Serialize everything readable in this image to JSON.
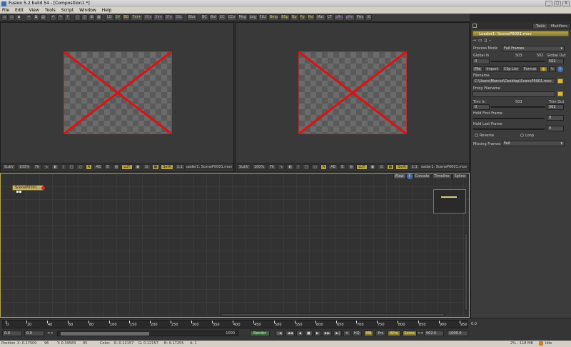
{
  "window": {
    "title": "Fusion 5.2 build 54 - [Composition1 *]",
    "minimize": "_",
    "maximize": "□",
    "close": "X"
  },
  "menu": [
    "File",
    "Edit",
    "View",
    "Tools",
    "Script",
    "Window",
    "Help"
  ],
  "toolbar": [
    "Bg",
    "BC",
    "Bol",
    "CC",
    "CCv",
    "Msg",
    "Log",
    "FLU",
    "Bmp",
    "BSp",
    "Bp",
    "Pp",
    "Rsl",
    "Mat",
    "CT",
    "pRn",
    "pRn",
    "Pisc",
    "XI"
  ],
  "toolbar_colored": [
    {
      "label": "LD",
      "tone": "grn"
    },
    {
      "label": "SV",
      "tone": "grn"
    },
    {
      "label": "BG",
      "tone": "yel"
    },
    {
      "label": "Txt+",
      "tone": "yel"
    },
    {
      "label": "3Cv",
      "tone": "pur"
    },
    {
      "label": "3Im",
      "tone": "pur"
    },
    {
      "label": "3Fo",
      "tone": "pur"
    },
    {
      "label": "3SL",
      "tone": "pur"
    },
    {
      "label": "Blur",
      "tone": ""
    }
  ],
  "viewer_left": {
    "sub": "SubV",
    "zoom": "100%",
    "fit": "Fit",
    "lut": "LUT",
    "smr": "SmR",
    "ratio": "1:1",
    "label": "oader1: SceneP0001.mov"
  },
  "viewer_right": {
    "sub": "SubV",
    "zoom": "100%",
    "fit": "Fit",
    "lut": "LUT",
    "smr": "SmR",
    "ratio": "1:1",
    "label": "oader1: SceneP0001.mov"
  },
  "panel": {
    "tabs": [
      "Tools",
      "Modifiers"
    ],
    "header": "Loader1: SceneP0001.mov",
    "process_mode_label": "Process Mode",
    "process_mode_value": "Full Frames",
    "global_in_label": "Global In",
    "global_in_value": "0",
    "global_mid": "503",
    "global_end": "502",
    "global_out_label": "Global Out",
    "global_out_value": "502",
    "subtabs": [
      "File",
      "Import",
      "Clip List",
      "Format"
    ],
    "filename_label": "Filename",
    "filename_value": "C:\\Users\\Marcos\\Desktop\\SceneP0001.mov",
    "proxy_label": "Proxy Filename",
    "trim_in_label": "Trim In",
    "trim_mid": "503",
    "trim_out_label": "Trim Out",
    "trim_in_value": "0",
    "trim_out_value": "502",
    "hold_first_label": "Hold First Frame",
    "hold_first_value": "0",
    "hold_last_label": "Hold Last Frame",
    "hold_last_value": "0",
    "reverse_label": "Reverse",
    "loop_label": "Loop",
    "missing_label": "Missing Frames",
    "missing_value": "Fail"
  },
  "flow": {
    "tabs": [
      "Flow",
      "Console",
      "Timeline",
      "Spline"
    ],
    "node_label": "SceneP0001..."
  },
  "timeline": {
    "ticks": [
      "0",
      "20",
      "40",
      "60",
      "80",
      "100",
      "150",
      "200",
      "250",
      "300",
      "350",
      "400",
      "450",
      "500",
      "550",
      "600",
      "650",
      "700",
      "750",
      "800",
      "850",
      "900",
      "950"
    ],
    "start": "0.0",
    "current": "0.0",
    "end_field": "1000",
    "render": "Render",
    "hq": "HQ",
    "mb": "MB",
    "prx": "Prx",
    "aprx": "APrx",
    "some": "Some",
    "range_end": "502.0",
    "total": "1000.0",
    "right_val": "0.0",
    "arrows": "<<",
    "arrows2": ">>"
  },
  "status": {
    "position_label": "Position",
    "x": "X:  0.17500",
    "xi": "96",
    "y": "Y:  0.39583",
    "yi": "95",
    "color_label": "Color:",
    "r": "R:  0.12157",
    "g": "G:  0.12157",
    "b": "B:  0.17255",
    "a": "A:  1",
    "memory": "2% - 118 MB",
    "state": "Idle"
  }
}
